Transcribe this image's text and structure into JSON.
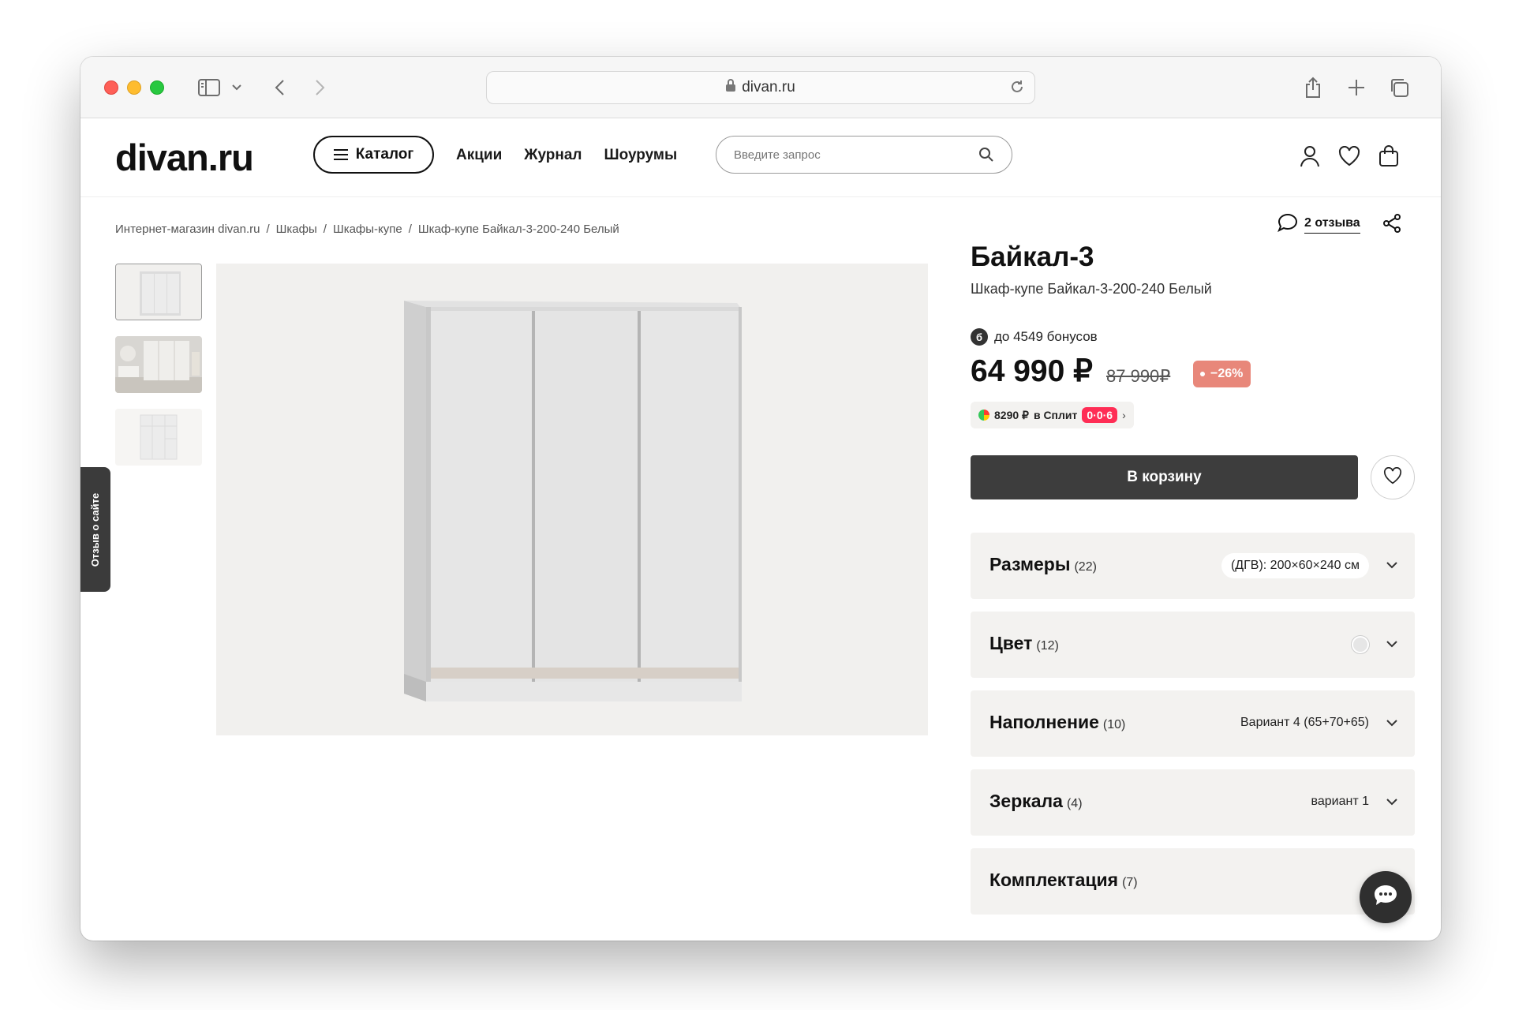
{
  "browser": {
    "url": "divan.ru"
  },
  "header": {
    "logo": "divan.ru",
    "catalog_label": "Каталог",
    "nav": [
      "Акции",
      "Журнал",
      "Шоурумы"
    ],
    "search_placeholder": "Введите запрос",
    "icons": [
      "user-icon",
      "heart-icon",
      "bag-icon"
    ]
  },
  "breadcrumb": [
    "Интернет-магазин divan.ru",
    "Шкафы",
    "Шкафы-купе",
    "Шкаф-купе Байкал-3-200-240 Белый"
  ],
  "gallery": {
    "thumbnails": [
      "wardrobe-front",
      "wardrobe-interior-room",
      "wardrobe-open"
    ],
    "feedback_tab": "Отзыв о сайте"
  },
  "product": {
    "reviews": "2 отзыва",
    "title": "Байкал-3",
    "subtitle": "Шкаф-купе Байкал-3-200-240 Белый",
    "bonus_icon": "б",
    "bonus": "до 4549 бонусов",
    "price": "64 990 ₽",
    "old_price": "87 990₽",
    "discount": "−26%",
    "split_amount": "8290 ₽",
    "split_text": "в Сплит",
    "split_badge": "0·0·6",
    "cart_button": "В корзину",
    "options": [
      {
        "label": "Размеры",
        "count": "(22)",
        "value": "(ДГВ): 200×60×240 см"
      },
      {
        "label": "Цвет",
        "count": "(12)",
        "value": ""
      },
      {
        "label": "Наполнение",
        "count": "(10)",
        "value": "Вариант 4 (65+70+65)"
      },
      {
        "label": "Зеркала",
        "count": "(4)",
        "value": "вариант 1"
      },
      {
        "label": "Комплектация",
        "count": "(7)",
        "value": ""
      }
    ]
  },
  "colors": {
    "accent_dark": "#3d3d3d",
    "discount": "#e8877a",
    "panel_bg": "#f3f2f0"
  }
}
